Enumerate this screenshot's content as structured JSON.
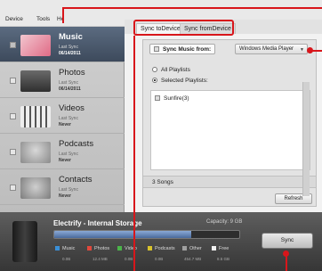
{
  "menubar": {
    "items": [
      "Device",
      "Tools",
      "He"
    ]
  },
  "sidebar": {
    "items": [
      {
        "title": "Music",
        "sub": "Last Sync",
        "date": "06/14/2011",
        "active": true
      },
      {
        "title": "Photos",
        "sub": "Last Sync",
        "date": "06/14/2011"
      },
      {
        "title": "Videos",
        "sub": "Last Sync",
        "date": "Never"
      },
      {
        "title": "Podcasts",
        "sub": "Last Sync",
        "date": "Never"
      },
      {
        "title": "Contacts",
        "sub": "Last Sync",
        "date": "Never"
      }
    ]
  },
  "tabs": [
    {
      "label": "Sync toDevice",
      "active": true
    },
    {
      "label": "Sync fromDevice",
      "active": false
    }
  ],
  "panel": {
    "sync_music_label": "Sync Music from:",
    "source_value": "Windows Media Player",
    "all_playlists": "All Playlists",
    "selected_playlists": "Selected Playlists:",
    "playlists": [
      "Sunfire(3)"
    ],
    "songs_count": "3 Songs",
    "refresh_label": "Refresh"
  },
  "storage": {
    "title": "Electrify - Internal Storage",
    "capacity": "Capacity: 9 GB",
    "legend": [
      {
        "label": "Music",
        "size": "0.0B",
        "color": "#3a8fd6"
      },
      {
        "label": "Photos",
        "size": "12.4 MB",
        "color": "#e2483c"
      },
      {
        "label": "Video",
        "size": "0.0B",
        "color": "#4bb54a"
      },
      {
        "label": "Podcasts",
        "size": "0.0B",
        "color": "#d8c22c"
      },
      {
        "label": "Other",
        "size": "454.7 MB",
        "color": "#a0a0a0"
      },
      {
        "label": "Free",
        "size": "8.5 GB",
        "color": "#f0f0f0"
      }
    ],
    "used_fraction": 0.74
  },
  "sync_label": "Sync",
  "colors": {
    "callout": "#d8161b",
    "active_item": "#4b596c"
  },
  "icons": [
    "music-thumb-icon",
    "photo-thumb-icon",
    "video-thumb-icon",
    "podcast-thumb-icon",
    "contacts-thumb-icon",
    "chevron-down-icon",
    "phone-device-icon"
  ]
}
